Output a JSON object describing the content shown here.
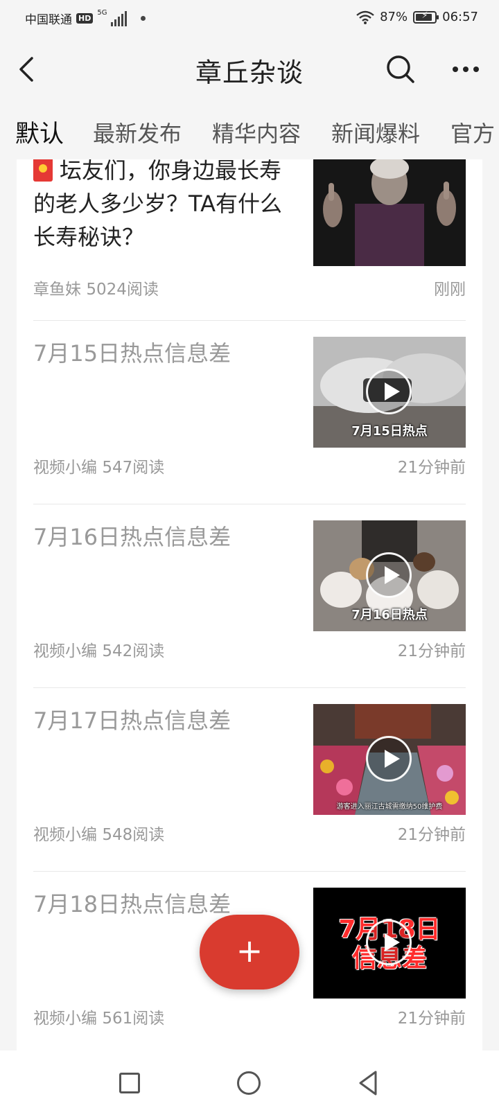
{
  "status_bar": {
    "carrier": "中国联通",
    "hd": "HD",
    "network": "5G",
    "battery": "87%",
    "battery_level": 0.87,
    "time": "06:57"
  },
  "header": {
    "title": "章丘杂谈",
    "icons": [
      "back-arrow-icon",
      "search-icon",
      "more-icon"
    ]
  },
  "tabs": [
    {
      "label": "默认",
      "active": true
    },
    {
      "label": "最新发布",
      "active": false
    },
    {
      "label": "精华内容",
      "active": false
    },
    {
      "label": "新闻爆料",
      "active": false
    },
    {
      "label": "官方",
      "active": false
    }
  ],
  "posts": [
    {
      "title": "坛友们，你身边最长寿的老人多少岁？TA有什么长寿秘诀？",
      "badge": "redbag-icon",
      "author": "章鱼妹",
      "reads": "5024阅读",
      "time": "刚刚",
      "is_video": false
    },
    {
      "title": "7月15日热点信息差",
      "author": "视频小编",
      "reads": "547阅读",
      "time": "21分钟前",
      "is_video": true,
      "thumb_caption": "7月15日热点"
    },
    {
      "title": "7月16日热点信息差",
      "author": "视频小编",
      "reads": "542阅读",
      "time": "21分钟前",
      "is_video": true,
      "thumb_caption": "7月16日热点"
    },
    {
      "title": "7月17日热点信息差",
      "author": "视频小编",
      "reads": "548阅读",
      "time": "21分钟前",
      "is_video": true,
      "thumb_caption": "游客进入丽江古城需缴纳50维护费"
    },
    {
      "title": "7月18日热点信息差",
      "author": "视频小编",
      "reads": "561阅读",
      "time": "21分钟前",
      "is_video": true,
      "thumb_text_line1": "7月18日",
      "thumb_text_line2": "信息差"
    }
  ],
  "fab": {
    "label": "+"
  },
  "colors": {
    "accent": "#d93b2f",
    "muted_text": "#999999",
    "background": "#f5f5f5"
  }
}
